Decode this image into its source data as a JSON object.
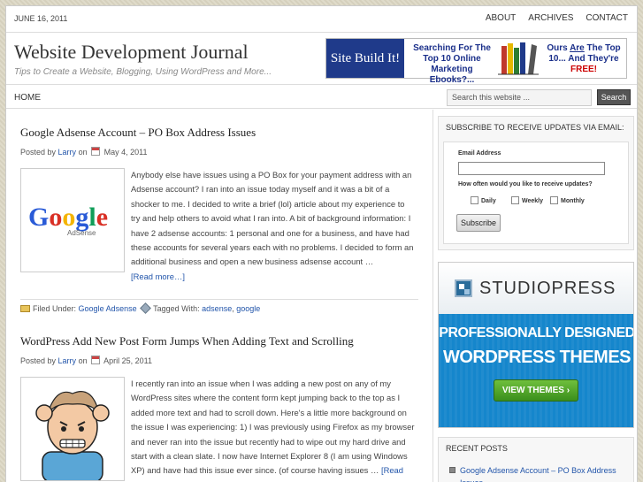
{
  "topnav": {
    "date": "June 16, 2011",
    "links": [
      "About",
      "Archives",
      "Contact"
    ]
  },
  "header": {
    "title": "Website Development Journal",
    "description": "Tips to Create a Website, Blogging, Using WordPress and More...",
    "banner": {
      "brand": "Site Build It!",
      "text1": "Searching For The Top 10 Online Marketing Ebooks?...",
      "text2_pre": "Ours ",
      "text2_are": "Are",
      "text2_mid": " The Top 10... And They're ",
      "text2_free": "FREE!"
    }
  },
  "menu": {
    "home": "Home",
    "search_placeholder": "Search this website ...",
    "search_button": "Search"
  },
  "posts": [
    {
      "title": "Google Adsense Account – PO Box Address Issues",
      "posted_by": "Posted by",
      "author": "Larry",
      "on": "on",
      "date": "May 4, 2011",
      "thumb_word": "Google",
      "thumb_sub": "AdSense",
      "excerpt": "Anybody else have issues using a PO Box for your payment address with an Adsense account? I ran into an issue today myself and it was a bit of a shocker to me. I decided to write a brief (lol) article about my experience to try and help others to avoid what I ran into. A bit of background information: I have 2 adsense accounts: 1 personal and one for a business, and have had these accounts for several years each with no problems. I decided to form an additional business and open a new business adsense account …",
      "read_more": "[Read more…]",
      "filed_under_label": "Filed Under:",
      "category": "Google Adsense",
      "tagged_label": "Tagged With:",
      "tag1": "adsense",
      "tag2": "google"
    },
    {
      "title": "WordPress Add New Post Form Jumps When Adding Text and Scrolling",
      "posted_by": "Posted by",
      "author": "Larry",
      "on": "on",
      "date": "April 25, 2011",
      "excerpt": "I recently ran into an issue when I was adding a new post on any of my WordPress sites where the content form kept jumping back to the top as I added more text and had to scroll down. Here's a little more background on the issue I was experiencing: 1) I was previously using Firefox as my browser and never ran into the issue but recently had to wipe out my hard drive and start with a clean slate. I now have Internet Explorer 8 (I am using Windows XP) and have had this issue ever since. (of course having issues …",
      "read_more": "[Read more…]"
    }
  ],
  "sidebar": {
    "subscribe": {
      "title": "Subscribe to receive updates via email:",
      "email_label": "Email Address",
      "freq_label": "How often would you like to receive updates?",
      "options": [
        "Daily",
        "Weekly",
        "Monthly"
      ],
      "button": "Subscribe"
    },
    "ad": {
      "brand": "STUDIOPRESS",
      "line1": "PROFESSIONALLY DESIGNED",
      "line2": "WORDPRESS THEMES",
      "cta": "VIEW THEMES"
    },
    "recent": {
      "title": "Recent Posts",
      "items": [
        "Google Adsense Account – PO Box Address Issues"
      ]
    }
  }
}
